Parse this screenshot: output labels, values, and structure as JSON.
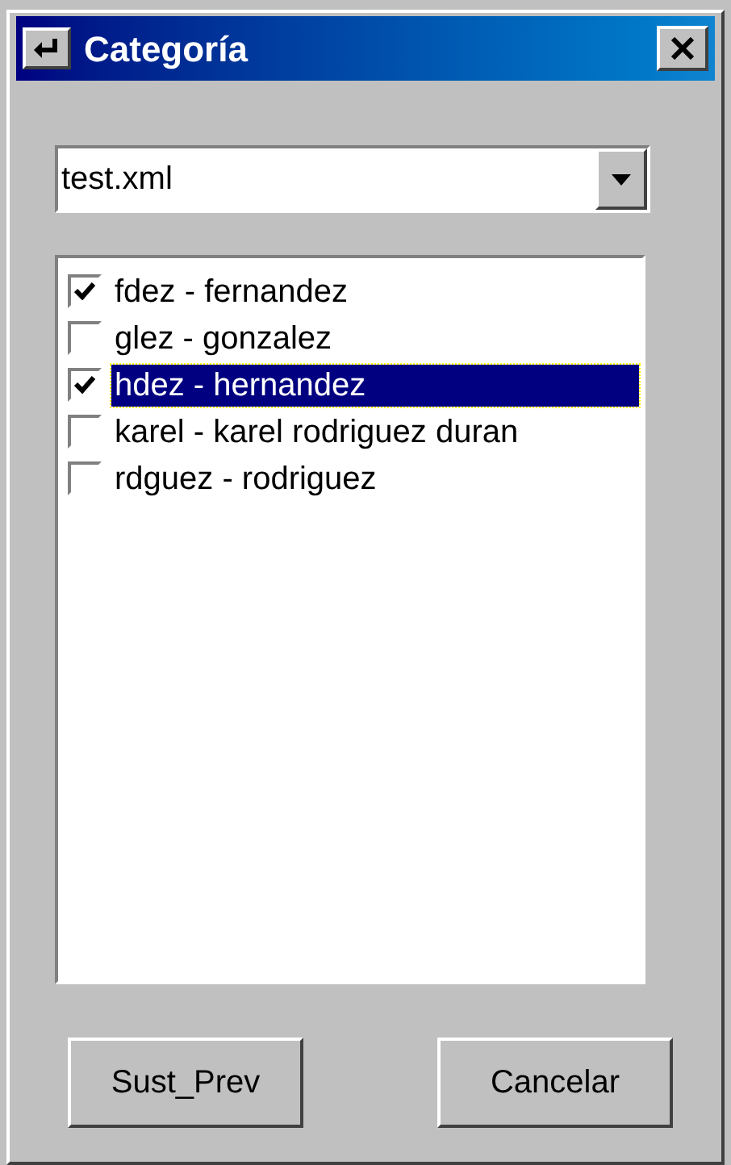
{
  "window": {
    "title": "Categoría"
  },
  "dropdown": {
    "value": "test.xml"
  },
  "list": {
    "items": [
      {
        "label": "fdez - fernandez",
        "checked": true,
        "selected": false
      },
      {
        "label": "glez - gonzalez",
        "checked": false,
        "selected": false
      },
      {
        "label": "hdez - hernandez",
        "checked": true,
        "selected": true
      },
      {
        "label": "karel - karel rodriguez duran",
        "checked": false,
        "selected": false
      },
      {
        "label": "rdguez - rodriguez",
        "checked": false,
        "selected": false
      }
    ]
  },
  "buttons": [
    "Sust_Prev",
    "Cancelar"
  ]
}
